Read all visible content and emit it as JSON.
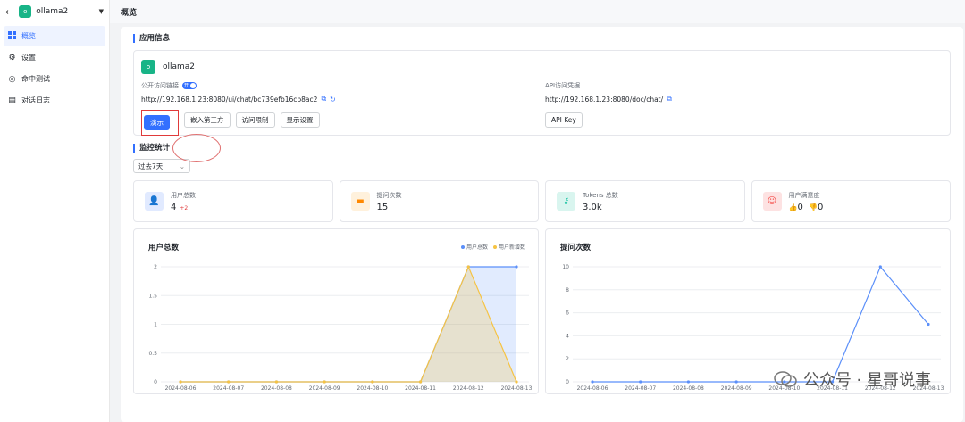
{
  "sidebar": {
    "app_name": "ollama2",
    "app_logo_letter": "o",
    "items": [
      {
        "label": "概览",
        "icon": "grid-icon"
      },
      {
        "label": "设置",
        "icon": "gear-icon"
      },
      {
        "label": "命中测试",
        "icon": "target-icon"
      },
      {
        "label": "对话日志",
        "icon": "document-icon"
      }
    ]
  },
  "header": {
    "title": "概览"
  },
  "app_info": {
    "section_title": "应用信息",
    "app_name": "ollama2",
    "public_link_label": "公开访问链接",
    "switch_text": "开",
    "public_url": "http://192.168.1.23:8080/ui/chat/bc739efb16cb8ac2",
    "api_label": "API访问凭据",
    "api_url": "http://192.168.1.23:8080/doc/chat/",
    "buttons": {
      "demo": "演示",
      "embed": "嵌入第三方",
      "access": "访问限制",
      "display": "显示设置",
      "api_key": "API Key"
    }
  },
  "monitor": {
    "section_title": "监控统计",
    "range": "过去7天",
    "stats": [
      {
        "label": "用户总数",
        "value": "4",
        "delta": "+2",
        "icon": "user-icon",
        "color": "#3370ff",
        "bg": "#e1eaff"
      },
      {
        "label": "提问次数",
        "value": "15",
        "icon": "message-icon",
        "color": "#ff8800",
        "bg": "#fff1dc"
      },
      {
        "label": "Tokens 总数",
        "value": "3.0k",
        "icon": "key-icon",
        "color": "#14c0a0",
        "bg": "#d9f5ef"
      },
      {
        "label": "用户满意度",
        "like": "0",
        "dislike": "0",
        "icon": "smile-icon",
        "color": "#f54a45",
        "bg": "#fde2e2"
      }
    ]
  },
  "chart_data": [
    {
      "type": "area",
      "title": "用户总数",
      "categories": [
        "2024-08-06",
        "2024-08-07",
        "2024-08-08",
        "2024-08-09",
        "2024-08-10",
        "2024-08-11",
        "2024-08-12",
        "2024-08-13"
      ],
      "series": [
        {
          "name": "用户总数",
          "color": "#5b8ff9",
          "values": [
            0,
            0,
            0,
            0,
            0,
            0,
            2,
            2
          ]
        },
        {
          "name": "用户新增数",
          "color": "#f6c343",
          "values": [
            0,
            0,
            0,
            0,
            0,
            0,
            2,
            0
          ]
        }
      ],
      "yticks": [
        "0",
        "0.5",
        "1",
        "1.5",
        "2"
      ],
      "ylim": [
        0,
        2
      ]
    },
    {
      "type": "line",
      "title": "提问次数",
      "categories": [
        "2024-08-06",
        "2024-08-07",
        "2024-08-08",
        "2024-08-09",
        "2024-08-10",
        "2024-08-11",
        "2024-08-12",
        "2024-08-13"
      ],
      "series": [
        {
          "color": "#5b8ff9",
          "values": [
            0,
            0,
            0,
            0,
            0,
            0,
            10,
            5
          ]
        }
      ],
      "yticks": [
        "0",
        "2",
        "4",
        "6",
        "8",
        "10"
      ],
      "ylim": [
        0,
        10
      ]
    }
  ],
  "watermark": "公众号 · 星哥说事"
}
